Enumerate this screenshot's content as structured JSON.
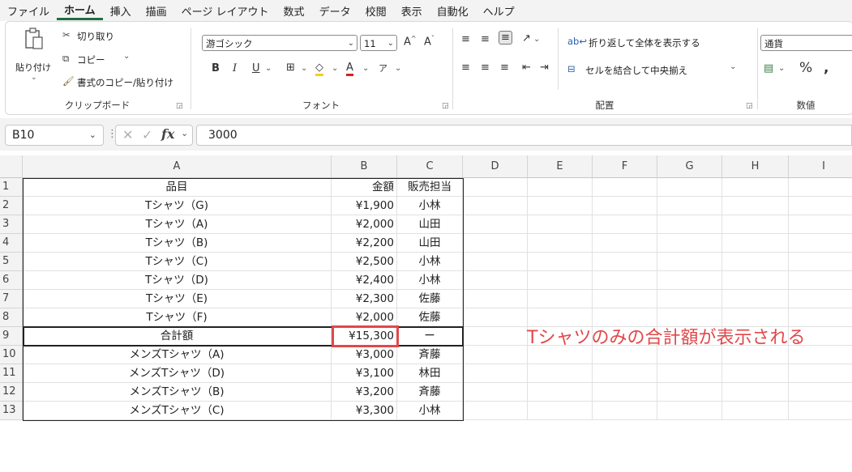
{
  "menu": [
    "ファイル",
    "ホーム",
    "挿入",
    "描画",
    "ページ レイアウト",
    "数式",
    "データ",
    "校閲",
    "表示",
    "自動化",
    "ヘルプ"
  ],
  "active_menu": "ホーム",
  "ribbon": {
    "clipboard": {
      "paste": "貼り付け",
      "cut": "切り取り",
      "copy": "コピー",
      "format_painter": "書式のコピー/貼り付け",
      "label": "クリップボード"
    },
    "font": {
      "name": "游ゴシック",
      "size": "11",
      "label": "フォント",
      "bold": "B",
      "italic": "I",
      "underline": "U"
    },
    "alignment": {
      "wrap": "折り返して全体を表示する",
      "merge": "セルを結合して中央揃え",
      "label": "配置"
    },
    "number": {
      "format": "通貨",
      "label": "数値",
      "percent": "%"
    }
  },
  "formula_bar": {
    "name_box": "B10",
    "formula": "3000"
  },
  "columns": [
    "A",
    "B",
    "C",
    "D",
    "E",
    "F",
    "G",
    "H",
    "I"
  ],
  "rows": [
    {
      "n": "1",
      "a": "品目",
      "b": "金額",
      "c": "販売担当"
    },
    {
      "n": "2",
      "a": "Tシャツ（G)",
      "b": "¥1,900",
      "c": "小林"
    },
    {
      "n": "3",
      "a": "Tシャツ（A)",
      "b": "¥2,000",
      "c": "山田"
    },
    {
      "n": "4",
      "a": "Tシャツ（B)",
      "b": "¥2,200",
      "c": "山田"
    },
    {
      "n": "5",
      "a": "Tシャツ（C)",
      "b": "¥2,500",
      "c": "小林"
    },
    {
      "n": "6",
      "a": "Tシャツ（D)",
      "b": "¥2,400",
      "c": "小林"
    },
    {
      "n": "7",
      "a": "Tシャツ（E)",
      "b": "¥2,300",
      "c": "佐藤"
    },
    {
      "n": "8",
      "a": "Tシャツ（F)",
      "b": "¥2,000",
      "c": "佐藤"
    },
    {
      "n": "9",
      "a": "合計額",
      "b": "¥15,300",
      "c": "ー"
    },
    {
      "n": "10",
      "a": "メンズTシャツ（A)",
      "b": "¥3,000",
      "c": "斉藤"
    },
    {
      "n": "11",
      "a": "メンズTシャツ（D)",
      "b": "¥3,100",
      "c": "林田"
    },
    {
      "n": "12",
      "a": "メンズTシャツ（B)",
      "b": "¥3,200",
      "c": "斉藤"
    },
    {
      "n": "13",
      "a": "メンズTシャツ（C)",
      "b": "¥3,300",
      "c": "小林"
    }
  ],
  "annotation": "Tシャツのみの合計額が表示される",
  "colors": {
    "accent": "#1f6e43",
    "highlight": "#e2474a"
  }
}
